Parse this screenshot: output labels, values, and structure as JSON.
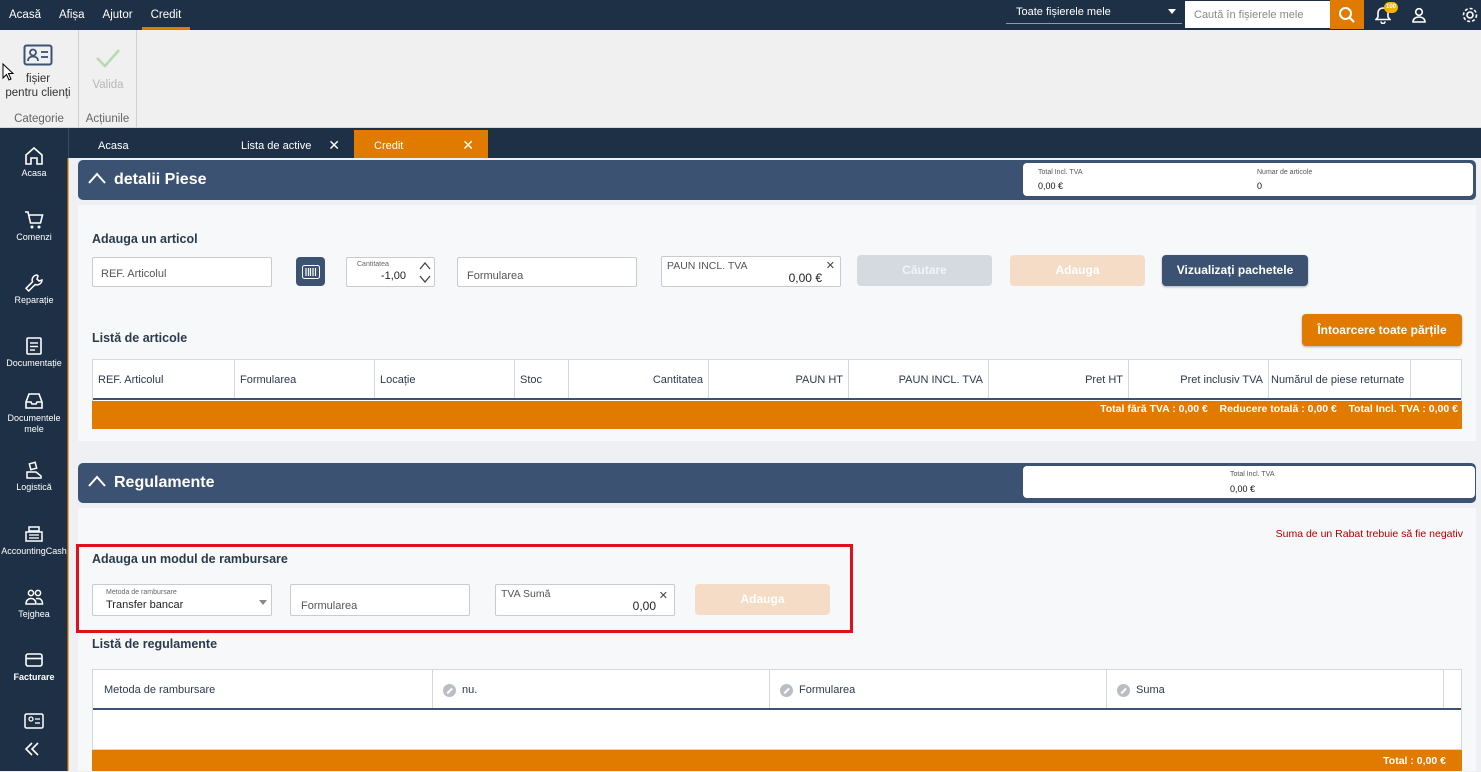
{
  "topnav": [
    "Acasă",
    "Afișa",
    "Ajutor",
    "Credit"
  ],
  "active_topnav": "Credit",
  "scope": {
    "selected": "Toate fișierele mele"
  },
  "search": {
    "placeholder": "Caută în fișierele mele"
  },
  "notifications": {
    "count": "100"
  },
  "ribbon": {
    "customer_file": {
      "line1": "fișier",
      "line2": "pentru clienți"
    },
    "validate": "Valida",
    "group_category": "Categorie",
    "group_actions": "Acțiunile"
  },
  "sidebar": [
    {
      "label": "Acasa",
      "icon": "home-icon"
    },
    {
      "label": "Comenzi",
      "icon": "cart-icon"
    },
    {
      "label": "Reparație",
      "icon": "wrench-icon"
    },
    {
      "label": "Documentație",
      "icon": "document-icon"
    },
    {
      "label": "Documentele mele",
      "icon": "inbox-icon"
    },
    {
      "label": "Logistică",
      "icon": "logistics-icon"
    },
    {
      "label": "AccountingCash",
      "icon": "cash-register-icon"
    },
    {
      "label": "Tejghea",
      "icon": "people-icon"
    },
    {
      "label": "Facturare",
      "icon": "card-icon"
    }
  ],
  "tabs": [
    {
      "label": "Acasa"
    },
    {
      "label": "Lista de active"
    },
    {
      "label": "Credit"
    }
  ],
  "parts": {
    "title": "detalii Piese",
    "total_label": "Total Incl. TVA",
    "total_value": "0,00 €",
    "count_label": "Numar de articole",
    "count_value": "0",
    "add_title": "Adauga un articol",
    "ref_placeholder": "REF. Articolul",
    "qty_label": "Cantitatea",
    "qty_value": "-1,00",
    "formula_placeholder": "Formularea",
    "price_label": "PAUN INCL. TVA",
    "price_value": "0,00 €",
    "search_btn": "Căutare",
    "add_btn": "Adauga",
    "packages_btn": "Vizualizați pachetele",
    "list_title": "Listă de articole",
    "return_all_btn": "Întoarcere toate părțile",
    "columns": [
      "REF. Articolul",
      "Formularea",
      "Locație",
      "Stoc",
      "Cantitatea",
      "PAUN HT",
      "PAUN INCL. TVA",
      "Pret HT",
      "Pret inclusiv TVA",
      "Numărul de piese returnate"
    ],
    "footer": "Total fără TVA : 0,00 €    Reducere totală : 0,00 €    Total Incl. TVA : 0,00 €"
  },
  "payments": {
    "title": "Regulamente",
    "total_label": "Total Incl. TVA",
    "total_value": "0,00 €",
    "warning": "Suma de un Rabat trebuie să fie negativ",
    "add_title": "Adauga un modul de rambursare",
    "method_label": "Metoda de rambursare",
    "method_value": "Transfer bancar",
    "formula_placeholder": "Formularea",
    "amount_label": "TVA Sumă",
    "amount_value": "0,00",
    "add_btn": "Adauga",
    "list_title": "Listă de regulamente",
    "columns": [
      "Metoda de rambursare",
      "nu.",
      "Formularea",
      "Suma"
    ],
    "footer": "Total : 0,00 €"
  },
  "colors": {
    "navy": "#1e3046",
    "header": "#3b5273",
    "accent": "#e07b00",
    "highlight": "#e0101a"
  }
}
